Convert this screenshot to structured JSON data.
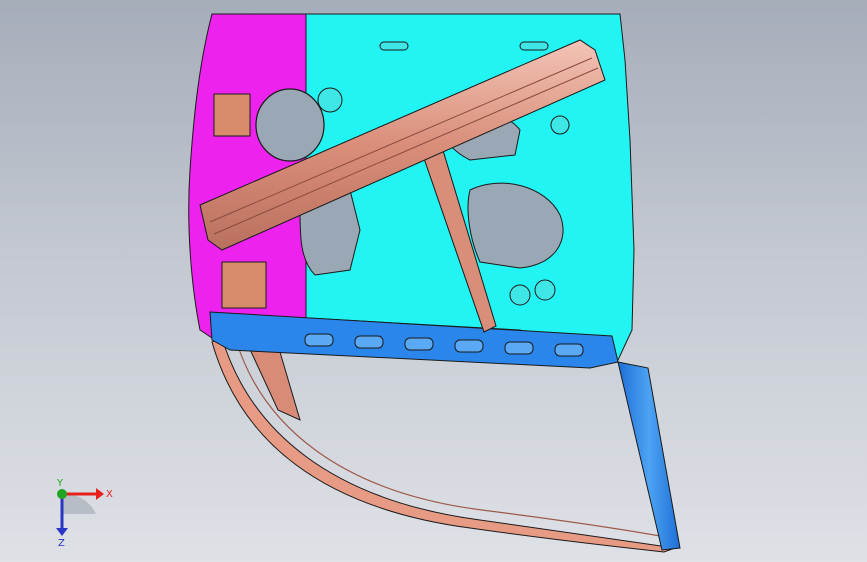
{
  "triad": {
    "x_label": "X",
    "y_label": "Y",
    "z_label": "Z",
    "colors": {
      "x": "#e8201c",
      "y": "#1fa51f",
      "z": "#2a35c8"
    }
  },
  "model": {
    "colors": {
      "inner_panel": "#22f3f3",
      "hinge_side_panel": "#ee22ee",
      "reinforcement_beam": "#e7a08e",
      "belt_line_beam": "#2a86ea",
      "window_frame": "#e79a84",
      "rear_pillar": "#2a86ea",
      "outline": "#1a1a1a"
    }
  }
}
